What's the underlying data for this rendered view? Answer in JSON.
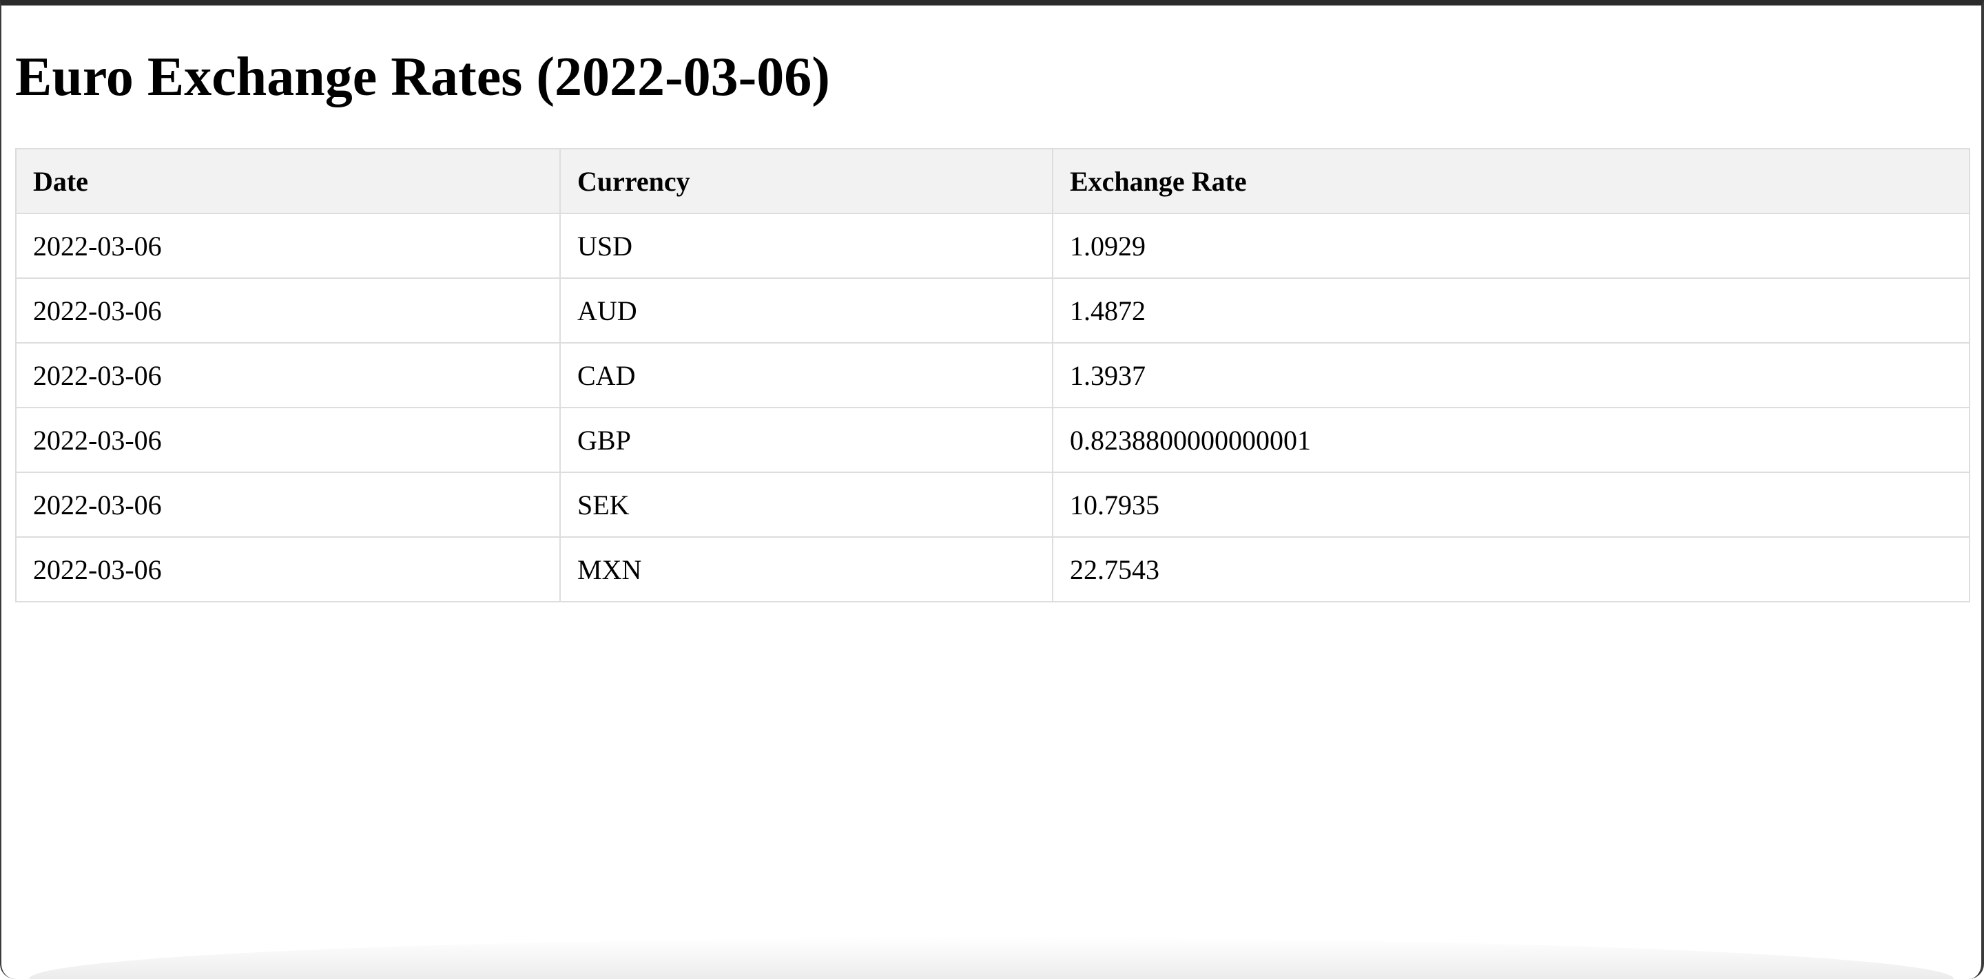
{
  "page": {
    "title": "Euro Exchange Rates (2022-03-06)"
  },
  "table": {
    "headers": [
      "Date",
      "Currency",
      "Exchange Rate"
    ],
    "rows": [
      [
        "2022-03-06",
        "USD",
        "1.0929"
      ],
      [
        "2022-03-06",
        "AUD",
        "1.4872"
      ],
      [
        "2022-03-06",
        "CAD",
        "1.3937"
      ],
      [
        "2022-03-06",
        "GBP",
        "0.8238800000000001"
      ],
      [
        "2022-03-06",
        "SEK",
        "10.7935"
      ],
      [
        "2022-03-06",
        "MXN",
        "22.7543"
      ]
    ]
  },
  "colors": {
    "header_bg": "#f2f2f2",
    "border": "#dddddd",
    "text": "#000000",
    "background": "#ffffff"
  }
}
